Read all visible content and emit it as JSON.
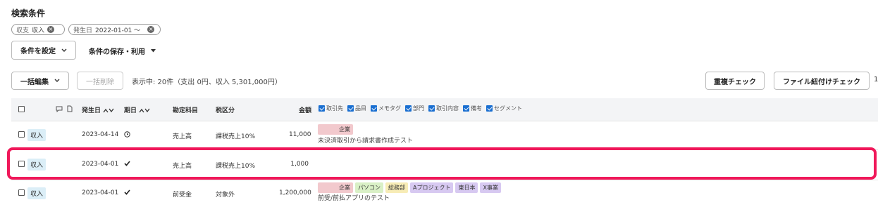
{
  "search": {
    "title": "検索条件",
    "chips": [
      {
        "key": "収支",
        "value": "収入"
      },
      {
        "key": "発生日",
        "value": "2022-01-01 ～"
      }
    ],
    "set_conditions_label": "条件を設定",
    "save_use_label": "条件の保存・利用"
  },
  "toolbar": {
    "bulk_edit_label": "一括編集",
    "bulk_delete_label": "一括削除",
    "summary": "表示中: 20件（支出 0円、収入 5,301,000円）",
    "duplicate_check_label": "重複チェック",
    "file_link_check_label": "ファイル紐付けチェック",
    "trailing_text": "1"
  },
  "table": {
    "headers": {
      "date": "発生日",
      "due": "期日",
      "account": "勘定科目",
      "tax": "税区分",
      "amount": "金額"
    },
    "column_options": [
      "取引先",
      "品目",
      "メモタグ",
      "部門",
      "取引内容",
      "備考",
      "セグメント"
    ],
    "rows": [
      {
        "type": "収入",
        "date": "2023-04-14",
        "due_icon": "clock-icon",
        "account": "売上高",
        "tax": "課税売上10%",
        "amount": "11,000",
        "tags": [
          {
            "text": "企業",
            "color": "red"
          }
        ],
        "memo": "未決済取引から請求書作成テスト"
      },
      {
        "type": "収入",
        "date": "2023-04-01",
        "due_icon": "check-icon",
        "account": "売上高",
        "tax": "課税売上10%",
        "amount": "1,000",
        "tags": [],
        "memo": ""
      },
      {
        "type": "収入",
        "date": "2023-04-01",
        "due_icon": "check-icon",
        "account": "前受金",
        "tax": "対象外",
        "amount": "1,200,000",
        "tags": [
          {
            "text": "企業",
            "color": "red"
          },
          {
            "text": "パソコン",
            "color": "green"
          },
          {
            "text": "総務部",
            "color": "yellow"
          },
          {
            "text": "Aプロジェクト",
            "color": "purple"
          },
          {
            "text": "東日本",
            "color": "purple"
          },
          {
            "text": "X事業",
            "color": "purple"
          }
        ],
        "memo": "前受/前払アプリのテスト"
      }
    ]
  },
  "colors": {
    "highlight": "#f0185a",
    "badge_bg": "#dbeef7",
    "checkbox_on": "#1a6fd1"
  }
}
